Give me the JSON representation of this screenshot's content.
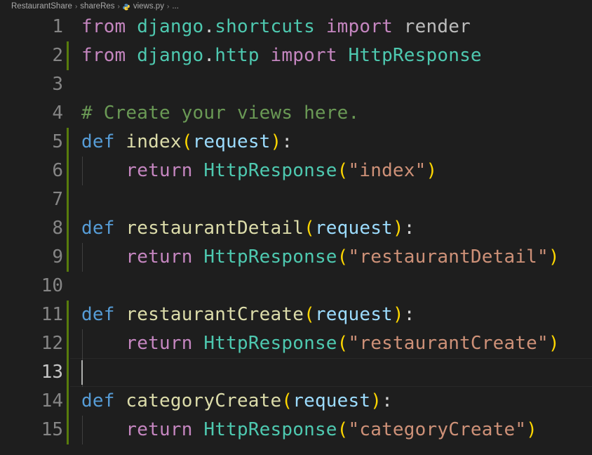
{
  "breadcrumb": {
    "project": "RestaurantShare",
    "folder": "shareRes",
    "file": "views.py",
    "more": "..."
  },
  "editor": {
    "active_line": 13,
    "lines": [
      {
        "number": "1",
        "tokens": [
          {
            "text": "from",
            "role": "keyword-import"
          },
          {
            "text": " ",
            "role": "plain"
          },
          {
            "text": "django",
            "role": "module"
          },
          {
            "text": ".",
            "role": "plain"
          },
          {
            "text": "shortcuts",
            "role": "module"
          },
          {
            "text": " ",
            "role": "plain"
          },
          {
            "text": "import",
            "role": "keyword-import"
          },
          {
            "text": " ",
            "role": "plain"
          },
          {
            "text": "render",
            "role": "dim-name"
          }
        ]
      },
      {
        "number": "2",
        "tokens": [
          {
            "text": "from",
            "role": "keyword-import"
          },
          {
            "text": " ",
            "role": "plain"
          },
          {
            "text": "django",
            "role": "module"
          },
          {
            "text": ".",
            "role": "plain"
          },
          {
            "text": "http",
            "role": "module"
          },
          {
            "text": " ",
            "role": "plain"
          },
          {
            "text": "import",
            "role": "keyword-import"
          },
          {
            "text": " ",
            "role": "plain"
          },
          {
            "text": "HttpResponse",
            "role": "class"
          }
        ]
      },
      {
        "number": "3",
        "tokens": []
      },
      {
        "number": "4",
        "tokens": [
          {
            "text": "# Create your views here.",
            "role": "comment"
          }
        ]
      },
      {
        "number": "5",
        "tokens": [
          {
            "text": "def",
            "role": "keyword-def"
          },
          {
            "text": " ",
            "role": "plain"
          },
          {
            "text": "index",
            "role": "function"
          },
          {
            "text": "(",
            "role": "paren"
          },
          {
            "text": "request",
            "role": "param"
          },
          {
            "text": ")",
            "role": "paren"
          },
          {
            "text": ":",
            "role": "plain"
          }
        ]
      },
      {
        "number": "6",
        "tokens": [
          {
            "text": "    ",
            "role": "plain"
          },
          {
            "text": "return",
            "role": "keyword-import"
          },
          {
            "text": " ",
            "role": "plain"
          },
          {
            "text": "HttpResponse",
            "role": "class"
          },
          {
            "text": "(",
            "role": "paren"
          },
          {
            "text": "\"index\"",
            "role": "string"
          },
          {
            "text": ")",
            "role": "paren"
          }
        ]
      },
      {
        "number": "7",
        "tokens": []
      },
      {
        "number": "8",
        "tokens": [
          {
            "text": "def",
            "role": "keyword-def"
          },
          {
            "text": " ",
            "role": "plain"
          },
          {
            "text": "restaurantDetail",
            "role": "function"
          },
          {
            "text": "(",
            "role": "paren"
          },
          {
            "text": "request",
            "role": "param"
          },
          {
            "text": ")",
            "role": "paren"
          },
          {
            "text": ":",
            "role": "plain"
          }
        ]
      },
      {
        "number": "9",
        "tokens": [
          {
            "text": "    ",
            "role": "plain"
          },
          {
            "text": "return",
            "role": "keyword-import"
          },
          {
            "text": " ",
            "role": "plain"
          },
          {
            "text": "HttpResponse",
            "role": "class"
          },
          {
            "text": "(",
            "role": "paren"
          },
          {
            "text": "\"restaurantDetail\"",
            "role": "string"
          },
          {
            "text": ")",
            "role": "paren"
          }
        ]
      },
      {
        "number": "10",
        "tokens": []
      },
      {
        "number": "11",
        "tokens": [
          {
            "text": "def",
            "role": "keyword-def"
          },
          {
            "text": " ",
            "role": "plain"
          },
          {
            "text": "restaurantCreate",
            "role": "function"
          },
          {
            "text": "(",
            "role": "paren"
          },
          {
            "text": "request",
            "role": "param"
          },
          {
            "text": ")",
            "role": "paren"
          },
          {
            "text": ":",
            "role": "plain"
          }
        ]
      },
      {
        "number": "12",
        "tokens": [
          {
            "text": "    ",
            "role": "plain"
          },
          {
            "text": "return",
            "role": "keyword-import"
          },
          {
            "text": " ",
            "role": "plain"
          },
          {
            "text": "HttpResponse",
            "role": "class"
          },
          {
            "text": "(",
            "role": "paren"
          },
          {
            "text": "\"restaurantCreate\"",
            "role": "string"
          },
          {
            "text": ")",
            "role": "paren"
          }
        ]
      },
      {
        "number": "13",
        "tokens": []
      },
      {
        "number": "14",
        "tokens": [
          {
            "text": "def",
            "role": "keyword-def"
          },
          {
            "text": " ",
            "role": "plain"
          },
          {
            "text": "categoryCreate",
            "role": "function"
          },
          {
            "text": "(",
            "role": "paren"
          },
          {
            "text": "request",
            "role": "param"
          },
          {
            "text": ")",
            "role": "paren"
          },
          {
            "text": ":",
            "role": "plain"
          }
        ]
      },
      {
        "number": "15",
        "tokens": [
          {
            "text": "    ",
            "role": "plain"
          },
          {
            "text": "return",
            "role": "keyword-import"
          },
          {
            "text": " ",
            "role": "plain"
          },
          {
            "text": "HttpResponse",
            "role": "class"
          },
          {
            "text": "(",
            "role": "paren"
          },
          {
            "text": "\"categoryCreate\"",
            "role": "string"
          },
          {
            "text": ")",
            "role": "paren"
          }
        ]
      }
    ],
    "modified_lines": [
      "2",
      "5",
      "6",
      "7",
      "8",
      "9",
      "11",
      "12",
      "13",
      "14",
      "15"
    ],
    "indented_lines": [
      "6",
      "9",
      "12",
      "13",
      "15"
    ]
  },
  "colors": {
    "background": "#1e1e1e",
    "keyword_import": "#c586c0",
    "keyword_def": "#569cd6",
    "module": "#4ec9b0",
    "function": "#dcdcaa",
    "param": "#9cdcfe",
    "string": "#ce9178",
    "comment": "#6a9955",
    "bracket": "#ffd700",
    "gutter_modified": "#587c0c"
  },
  "icons": {
    "file_type": "python-file-icon",
    "separator": "chevron-right-icon"
  }
}
